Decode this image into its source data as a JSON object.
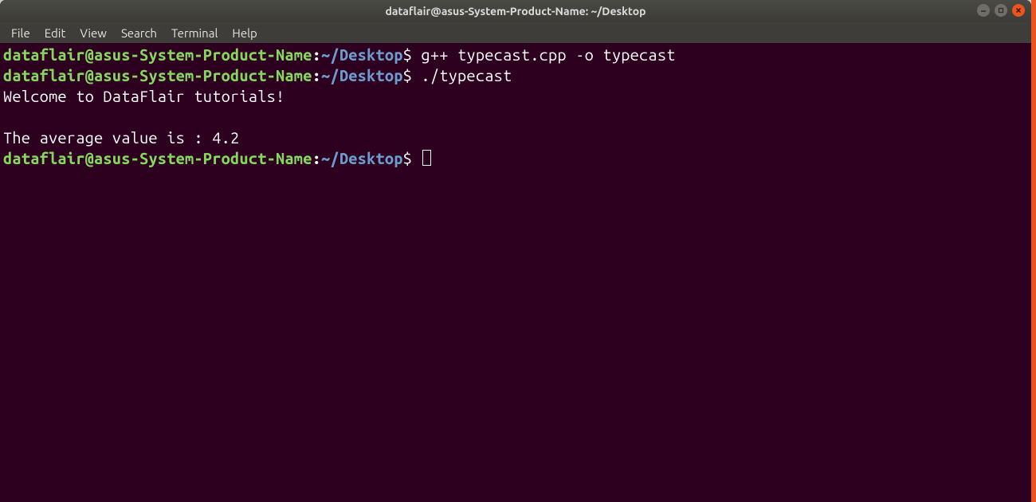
{
  "titlebar": {
    "title": "dataflair@asus-System-Product-Name: ~/Desktop"
  },
  "menubar": {
    "items": [
      "File",
      "Edit",
      "View",
      "Search",
      "Terminal",
      "Help"
    ]
  },
  "prompt": {
    "user_host": "dataflair@asus-System-Product-Name",
    "colon": ":",
    "path": "~/Desktop",
    "dollar": "$"
  },
  "lines": {
    "cmd1": " g++ typecast.cpp -o typecast",
    "cmd2": " ./typecast",
    "out1": "Welcome to DataFlair tutorials!",
    "blank": "",
    "out2": "The average value is : 4.2",
    "cmd3": " "
  }
}
